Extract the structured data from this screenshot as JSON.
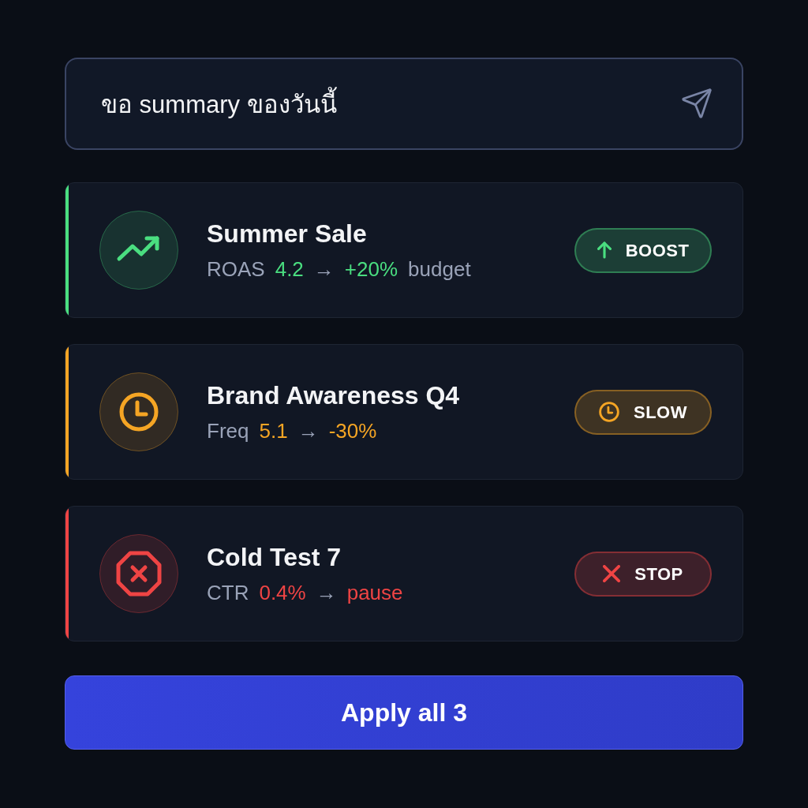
{
  "prompt": {
    "value": "ขอ summary ของวันนี้"
  },
  "campaigns": [
    {
      "kind": "boost",
      "color": "#4ade80",
      "name": "Summer Sale",
      "metric": "ROAS",
      "value": "4.2",
      "arrow": "→",
      "result": "+20%",
      "note": "budget",
      "action": "BOOST"
    },
    {
      "kind": "slow",
      "color": "#f5a524",
      "name": "Brand Awareness Q4",
      "metric": "Freq",
      "value": "5.1",
      "arrow": "→",
      "result": "-30%",
      "action": "SLOW"
    },
    {
      "kind": "stop",
      "color": "#ef4444",
      "name": "Cold Test 7",
      "metric": "CTR",
      "value": "0.4%",
      "arrow": "→",
      "result": "pause",
      "action": "STOP"
    }
  ],
  "apply_button": {
    "label": "Apply all 3"
  }
}
